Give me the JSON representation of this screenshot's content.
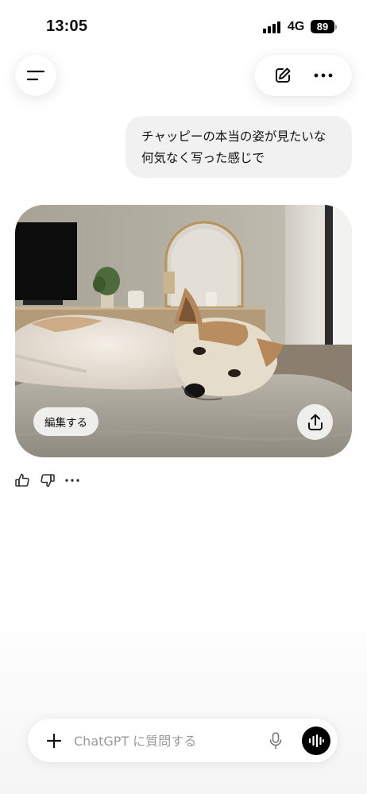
{
  "status_bar": {
    "time": "13:05",
    "network": "4G",
    "battery": "89"
  },
  "header": {
    "menu_icon": "sidebar-menu-icon",
    "new_chat_icon": "new-chat-edit-icon",
    "more_icon": "more-dots-icon"
  },
  "conversation": {
    "user_message": {
      "lines": [
        "チャッピーの本当の姿が見たいな",
        "何気なく写った感じで"
      ]
    },
    "assistant_image": {
      "edit_label": "編集する",
      "share_icon": "share-upload-icon"
    },
    "feedback": {
      "thumbs_up_icon": "thumbs-up-icon",
      "thumbs_down_icon": "thumbs-down-icon",
      "more_icon": "more-dots-icon"
    }
  },
  "composer": {
    "placeholder": "ChatGPT に質問する",
    "plus_icon": "plus-icon",
    "mic_icon": "microphone-icon",
    "voice_icon": "voice-mode-icon"
  },
  "colors": {
    "bubble_bg": "#f1f1f1",
    "voice_button_bg": "#000000"
  }
}
